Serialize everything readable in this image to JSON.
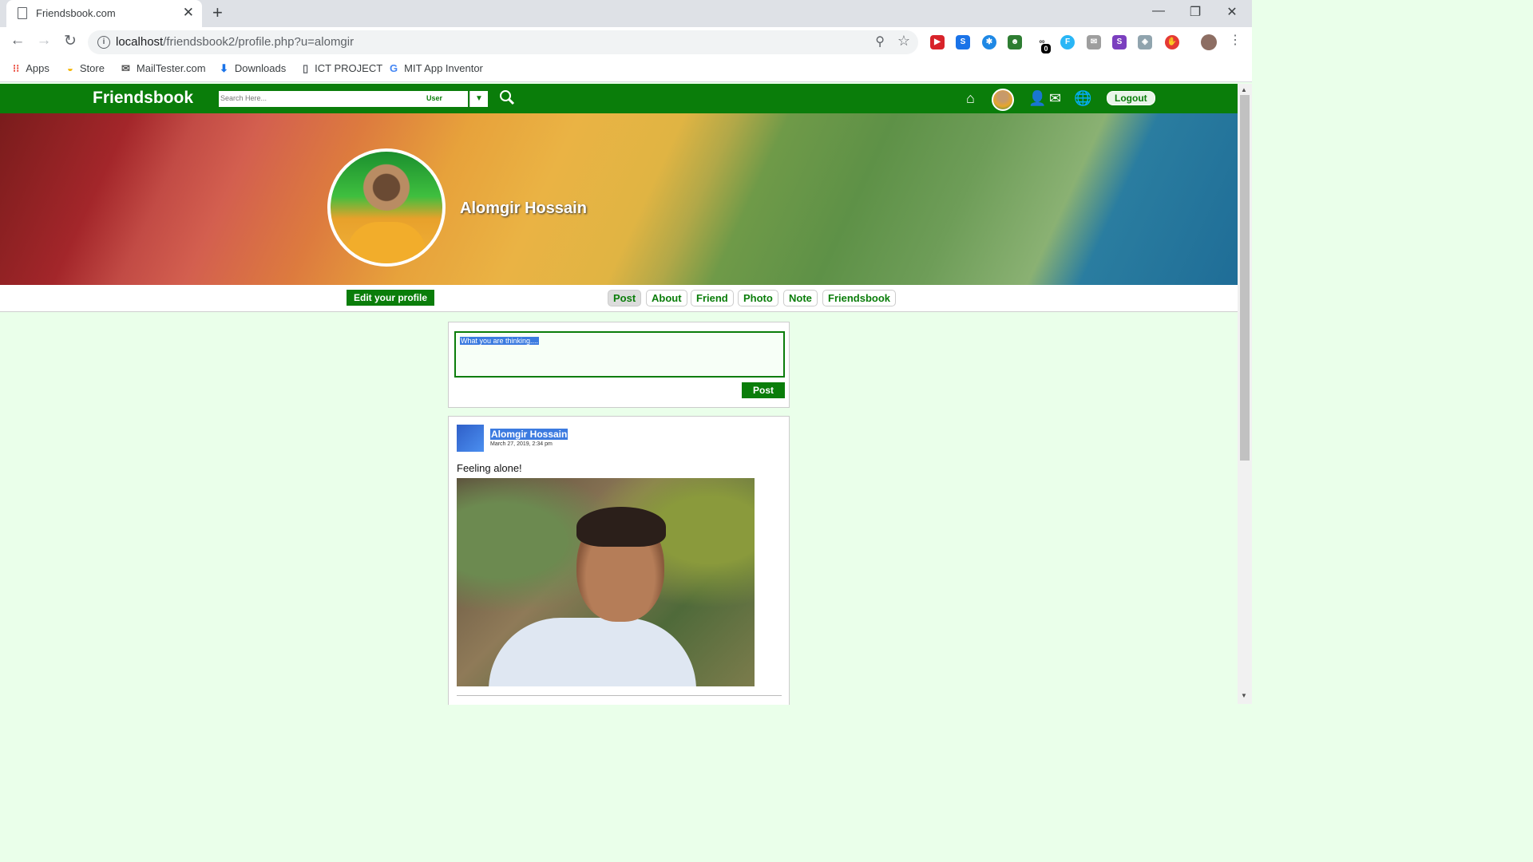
{
  "browser": {
    "tab_title": "Friendsbook.com",
    "url_host": "localhost",
    "url_path": "/friendsbook2/profile.php?u=alomgir",
    "bookmarks": [
      "Apps",
      "Store",
      "MailTester.com",
      "Downloads",
      "ICT PROJECT",
      "MIT App Inventor"
    ],
    "extension_badge": "0"
  },
  "site": {
    "logo": "Friendsbook",
    "search_placeholder": "Search Here...",
    "search_type": "User",
    "logout_label": "Logout"
  },
  "profile": {
    "name": "Alomgir Hossain",
    "edit_label": "Edit your profile",
    "tabs": [
      "Post",
      "About",
      "Friend",
      "Photo",
      "Note",
      "Friendsbook"
    ],
    "active_tab": "Post"
  },
  "composer": {
    "placeholder": "What you are thinking....",
    "post_label": "Post"
  },
  "post": {
    "author": "Alomgir Hossain",
    "date": "March 27, 2019, 2:34 pm",
    "text": "Feeling alone!"
  },
  "colors": {
    "brand_green": "#0a7d0a",
    "page_bg": "#eaffea",
    "selection_blue": "#3c7be0"
  }
}
